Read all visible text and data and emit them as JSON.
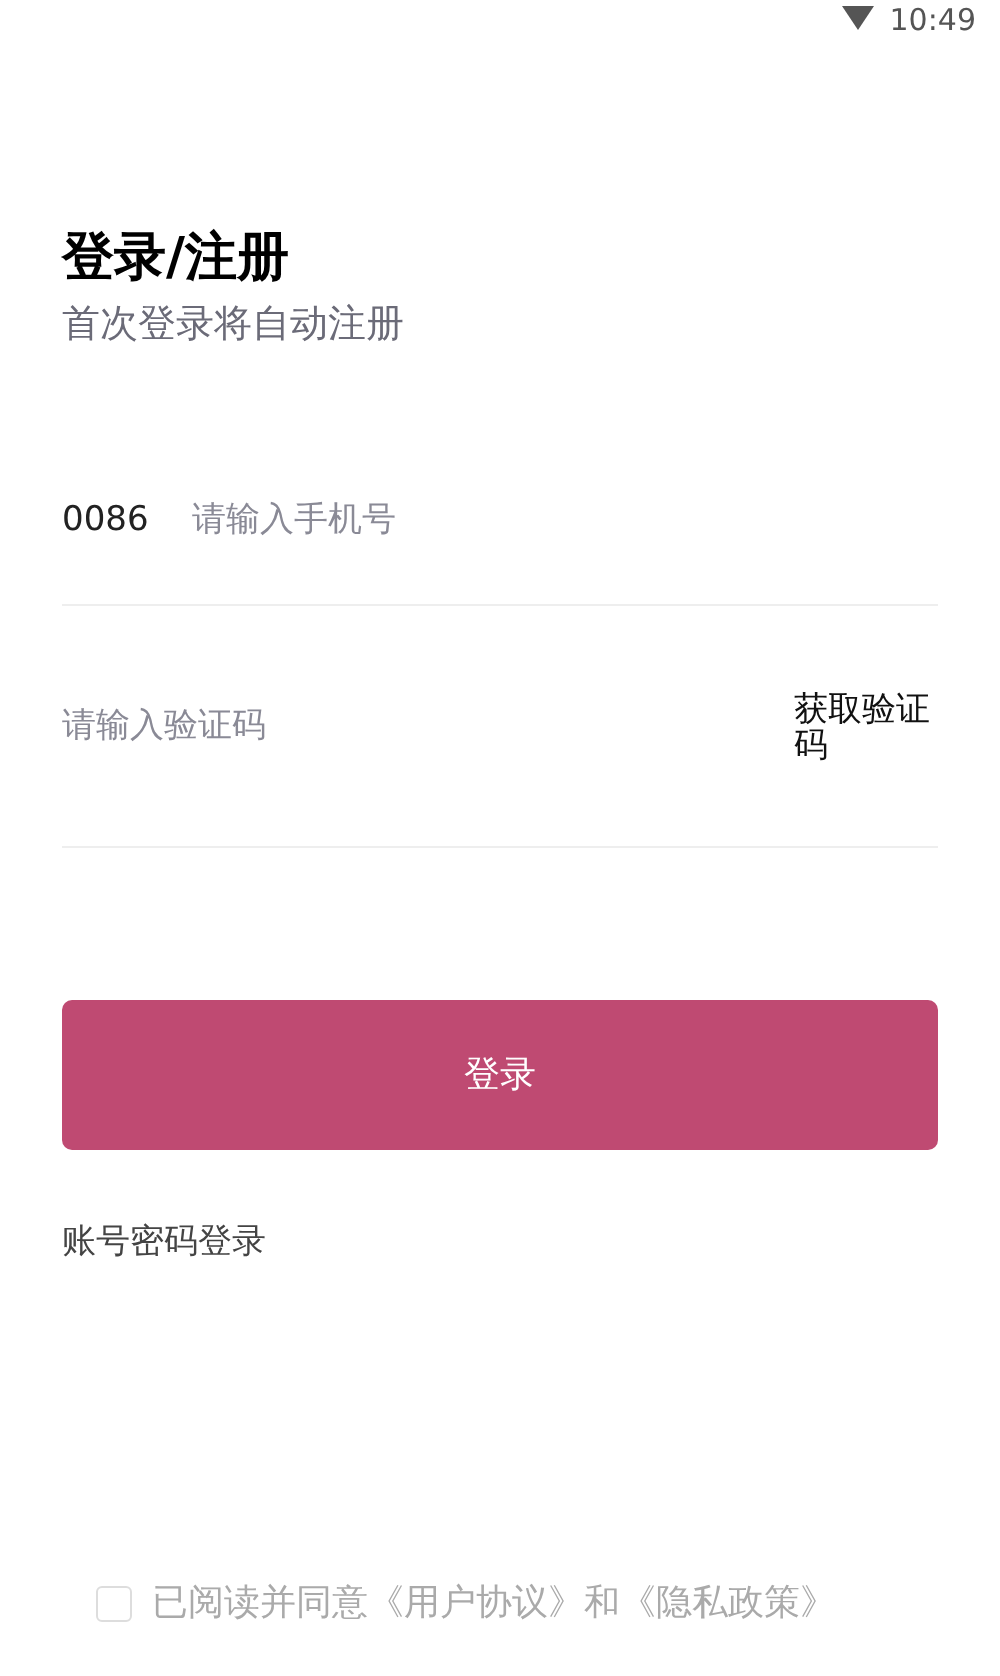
{
  "status_bar": {
    "time": "10:49"
  },
  "title": "登录/注册",
  "subtitle": "首次登录将自动注册",
  "phone": {
    "prefix": "0086",
    "placeholder": "请输入手机号"
  },
  "code": {
    "placeholder": "请输入验证码",
    "button": "获取验证码"
  },
  "login_button": "登录",
  "password_login": "账号密码登录",
  "agreement": {
    "checked": false,
    "text": "已阅读并同意《用户协议》和《隐私政策》"
  }
}
